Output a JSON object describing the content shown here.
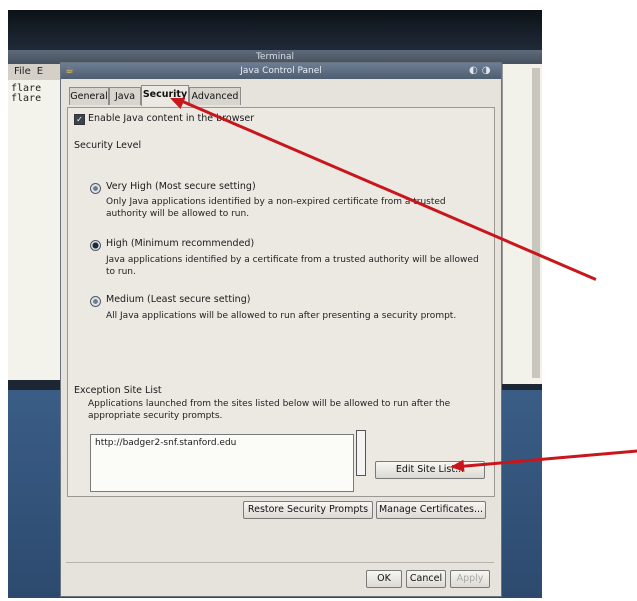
{
  "terminal": {
    "title": "Terminal",
    "menu": [
      "File",
      "E"
    ],
    "lines": [
      "flare",
      "flare"
    ]
  },
  "dialog": {
    "title": "Java Control Panel",
    "tabs": [
      "General",
      "Java",
      "Security",
      "Advanced"
    ],
    "active_tab": "Security",
    "enable_java_label": "Enable Java content in the browser",
    "security_level_label": "Security Level",
    "levels": [
      {
        "label": "Very High (Most secure setting)",
        "desc": [
          "Only Java applications identified by a non-expired certificate from a trusted",
          "authority will be allowed to run."
        ]
      },
      {
        "label": "High (Minimum recommended)",
        "desc": [
          "Java applications identified by a certificate from a trusted authority will be allowed",
          "to run."
        ]
      },
      {
        "label": "Medium (Least secure setting)",
        "desc": [
          "All Java applications will be allowed to run after presenting a security prompt."
        ]
      }
    ],
    "selected_level": "High (Minimum recommended)",
    "exception": {
      "heading": "Exception Site List",
      "desc": [
        "Applications launched from the sites listed below will be allowed to run after the",
        "appropriate security prompts."
      ],
      "sites": [
        "http://badger2-snf.stanford.edu"
      ],
      "edit_button": "Edit Site List..."
    },
    "restore_button": "Restore Security Prompts",
    "manage_button": "Manage Certificates...",
    "ok_button": "OK",
    "cancel_button": "Cancel",
    "apply_button": "Apply"
  },
  "annotation_color": "#c8161c"
}
